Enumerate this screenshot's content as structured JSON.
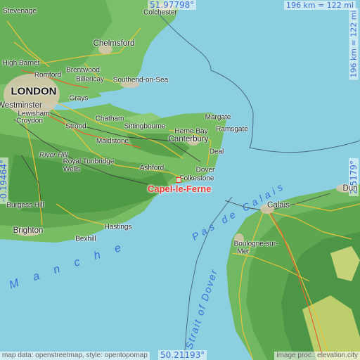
{
  "coordinates": {
    "north": "51.97798°",
    "south": "50.21193°",
    "west": "-0.19464°",
    "east": "2.5179°"
  },
  "scale": {
    "top": "196 km = 122 mi",
    "right": "196 km = 122 mi"
  },
  "credits": {
    "left": "map data: openstreetmap, style: opentopomap",
    "right": "image proc.: elevation.city"
  },
  "marker": {
    "label": "Capel-le-Ferne",
    "color": "#e8372f"
  },
  "seas": {
    "manche": "Manche",
    "pas_de_calais": "Pas de Calais",
    "strait_of_dover": "Strait of Dover"
  },
  "places": [
    {
      "name": "Colchester",
      "size": "small"
    },
    {
      "name": "Stevenage",
      "size": "small"
    },
    {
      "name": "Chelmsford",
      "size": "medium"
    },
    {
      "name": "High Barnet",
      "size": "small"
    },
    {
      "name": "Romford",
      "size": "small"
    },
    {
      "name": "Brentwood",
      "size": "small"
    },
    {
      "name": "Billericay",
      "size": "small"
    },
    {
      "name": "Southend-on-Sea",
      "size": "small"
    },
    {
      "name": "LONDON",
      "size": "big"
    },
    {
      "name": "Westminster",
      "size": "small"
    },
    {
      "name": "Lewisham",
      "size": "small"
    },
    {
      "name": "Croydon",
      "size": "small"
    },
    {
      "name": "Grays",
      "size": "small"
    },
    {
      "name": "Chatham",
      "size": "small"
    },
    {
      "name": "Strood",
      "size": "small"
    },
    {
      "name": "Sittingbourne",
      "size": "small"
    },
    {
      "name": "Margate",
      "size": "small"
    },
    {
      "name": "Herne Bay",
      "size": "small"
    },
    {
      "name": "Ramsgate",
      "size": "small"
    },
    {
      "name": "Canterbury",
      "size": "medium"
    },
    {
      "name": "Maidstone",
      "size": "small"
    },
    {
      "name": "Deal",
      "size": "small"
    },
    {
      "name": "River Hill",
      "size": "small"
    },
    {
      "name": "Royal Tunbridge",
      "size": "small"
    },
    {
      "name": "Wells",
      "size": "small"
    },
    {
      "name": "Ashford",
      "size": "small"
    },
    {
      "name": "Dover",
      "size": "small"
    },
    {
      "name": "Folkestone",
      "size": "small"
    },
    {
      "name": "Burgess Hill",
      "size": "small"
    },
    {
      "name": "Brighton",
      "size": "medium"
    },
    {
      "name": "Hastings",
      "size": "small"
    },
    {
      "name": "Bexhill",
      "size": "small"
    },
    {
      "name": "Calais",
      "size": "medium"
    },
    {
      "name": "Dun",
      "size": "medium"
    },
    {
      "name": "Boulogne-sur-",
      "size": "small"
    },
    {
      "name": "Mer",
      "size": "small"
    }
  ]
}
